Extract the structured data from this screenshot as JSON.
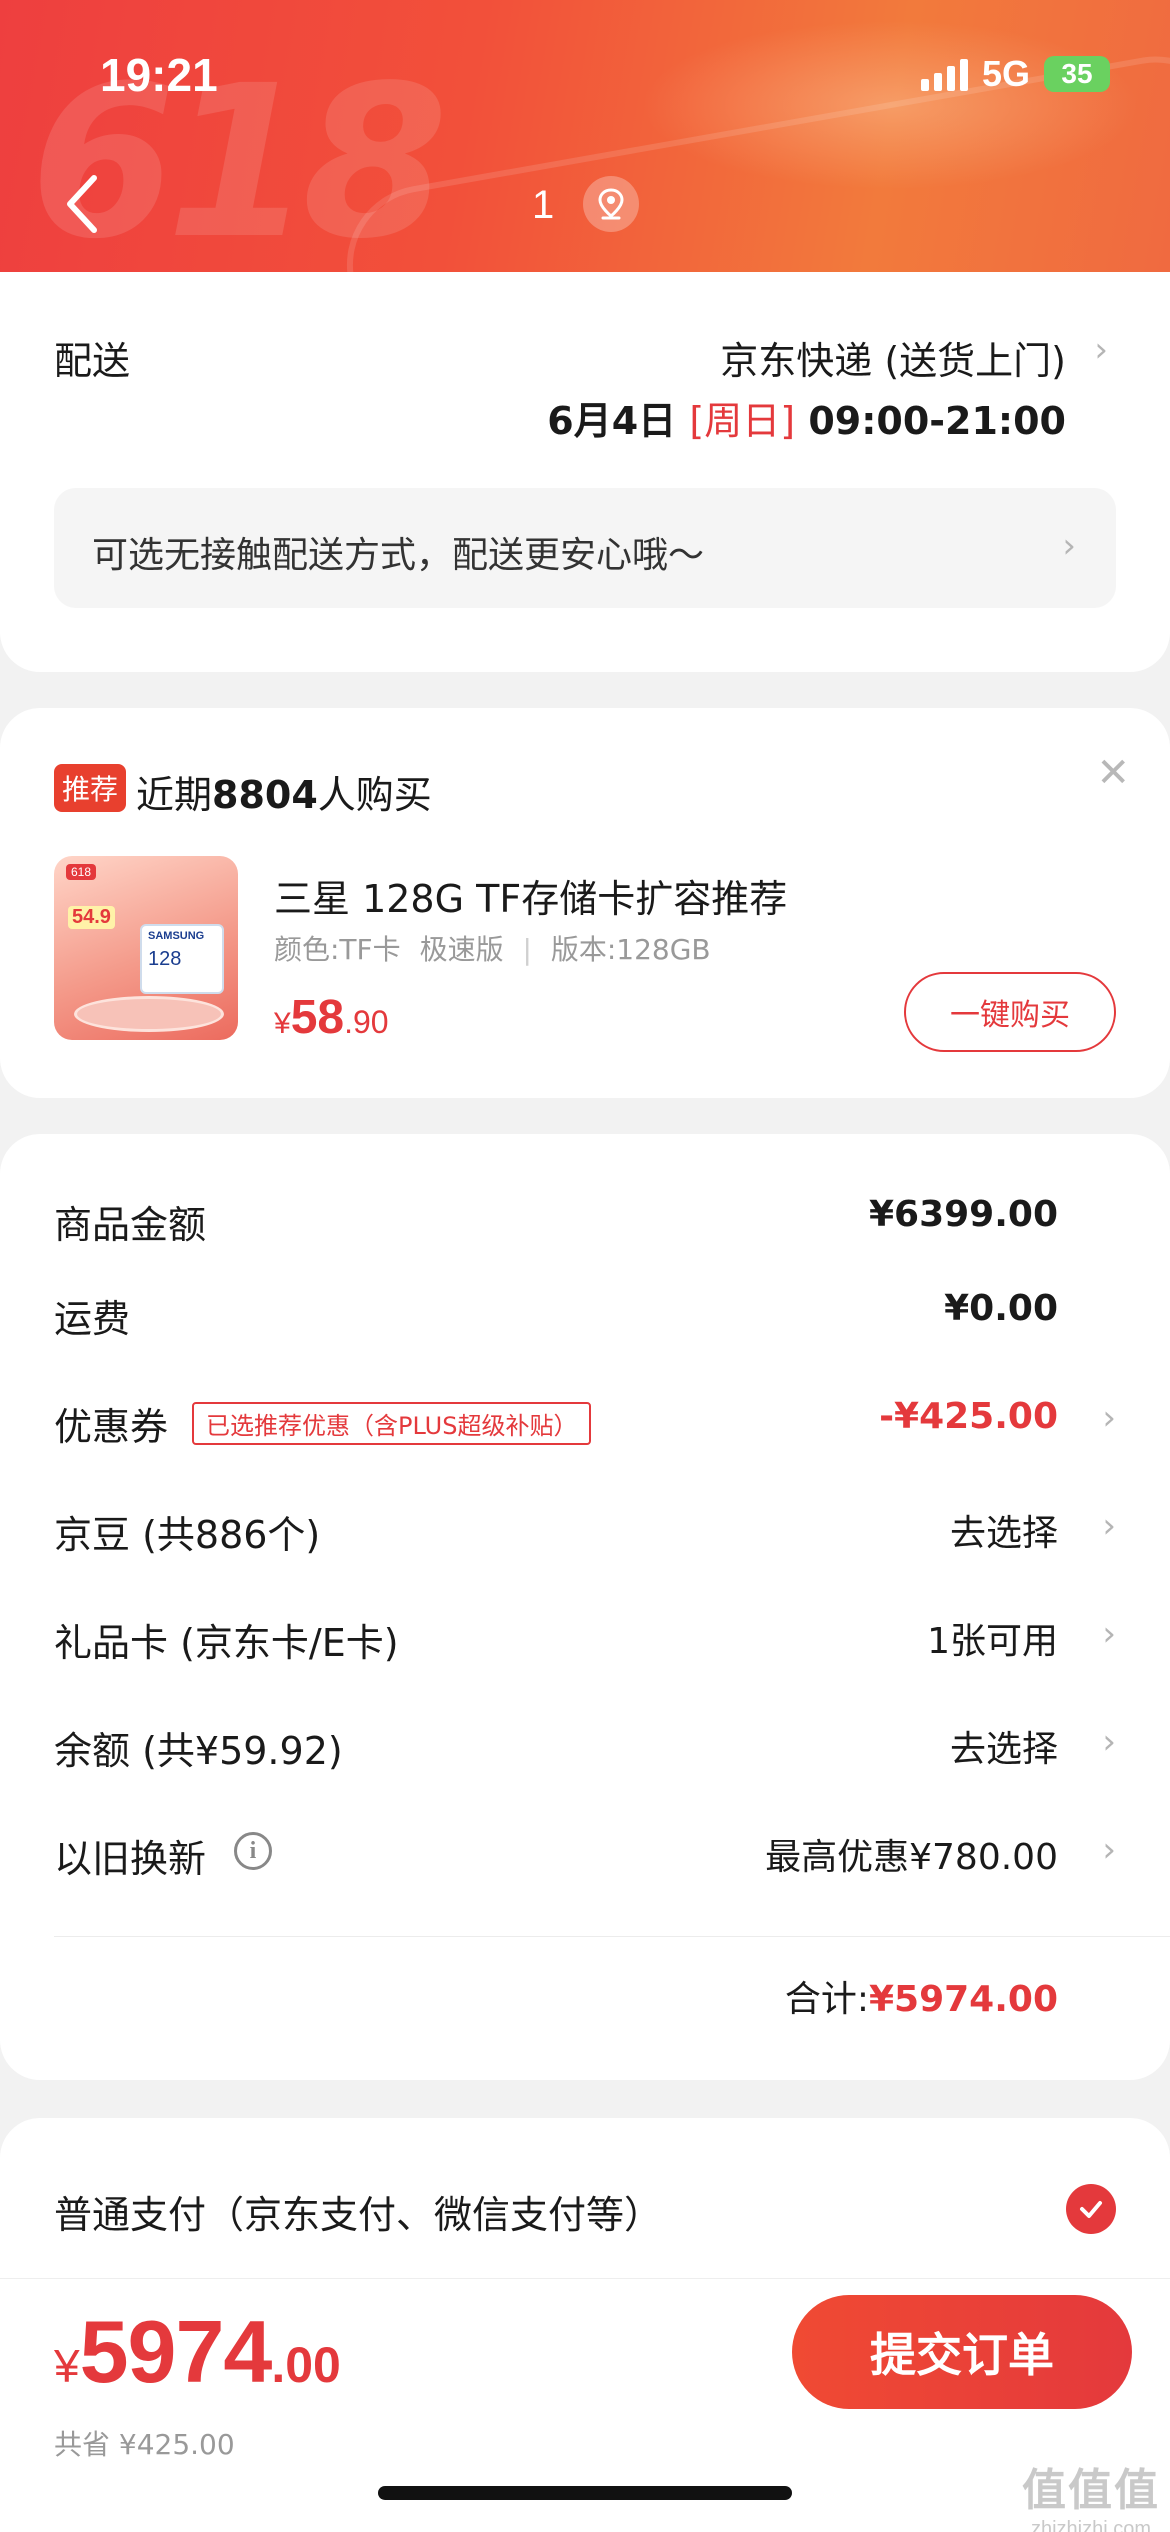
{
  "status": {
    "time": "19:21",
    "network": "5G",
    "battery": "35"
  },
  "header": {
    "page_indicator": "1"
  },
  "delivery": {
    "label": "配送",
    "carrier": "京东快递 (送货上门)",
    "date": "6月4日",
    "weekday": "[周日]",
    "time_window": "09:00-21:00",
    "contactless_text": "可选无接触配送方式，配送更安心哦～"
  },
  "recommendation": {
    "badge": "推荐",
    "headline_prefix": "近期",
    "headline_count": "8804",
    "headline_suffix": "人购买",
    "product_name": "三星 128G TF存储卡扩容推荐",
    "spec_color": "颜色:TF卡",
    "spec_speed": "极速版",
    "spec_version": "版本:128GB",
    "price_currency": "¥",
    "price_int": "58",
    "price_dec": ".90",
    "buy_button": "一键购买",
    "thumb": {
      "tag": "618",
      "price": "54.9",
      "brand": "SAMSUNG",
      "capacity": "128"
    }
  },
  "costs": {
    "goods_label": "商品金额",
    "goods_value": "¥6399.00",
    "freight_label": "运费",
    "freight_value": "¥0.00",
    "coupon_label": "优惠券",
    "coupon_tag": "已选推荐优惠（含PLUS超级补贴）",
    "coupon_value": "-¥425.00",
    "beans_label": "京豆 (共886个)",
    "beans_value": "去选择",
    "giftcard_label": "礼品卡 (京东卡/E卡)",
    "giftcard_value": "1张可用",
    "balance_label": "余额 (共¥59.92)",
    "balance_value": "去选择",
    "tradein_label": "以旧换新",
    "tradein_value": "最高优惠¥780.00",
    "total_label": "合计:",
    "total_value": "¥5974.00"
  },
  "payment": {
    "method": "普通支付（京东支付、微信支付等）"
  },
  "bottom": {
    "currency": "¥",
    "amount_int": "5974",
    "amount_dec": ".00",
    "saved": "共省 ¥425.00",
    "submit": "提交订单"
  },
  "watermark": {
    "glyphs": "值值值",
    "domain": "zhizhizhi.com"
  },
  "colors": {
    "accent": "#e4393c",
    "header_start": "#ee3f3f",
    "header_end": "#f27a3c",
    "battery": "#6ad160"
  }
}
